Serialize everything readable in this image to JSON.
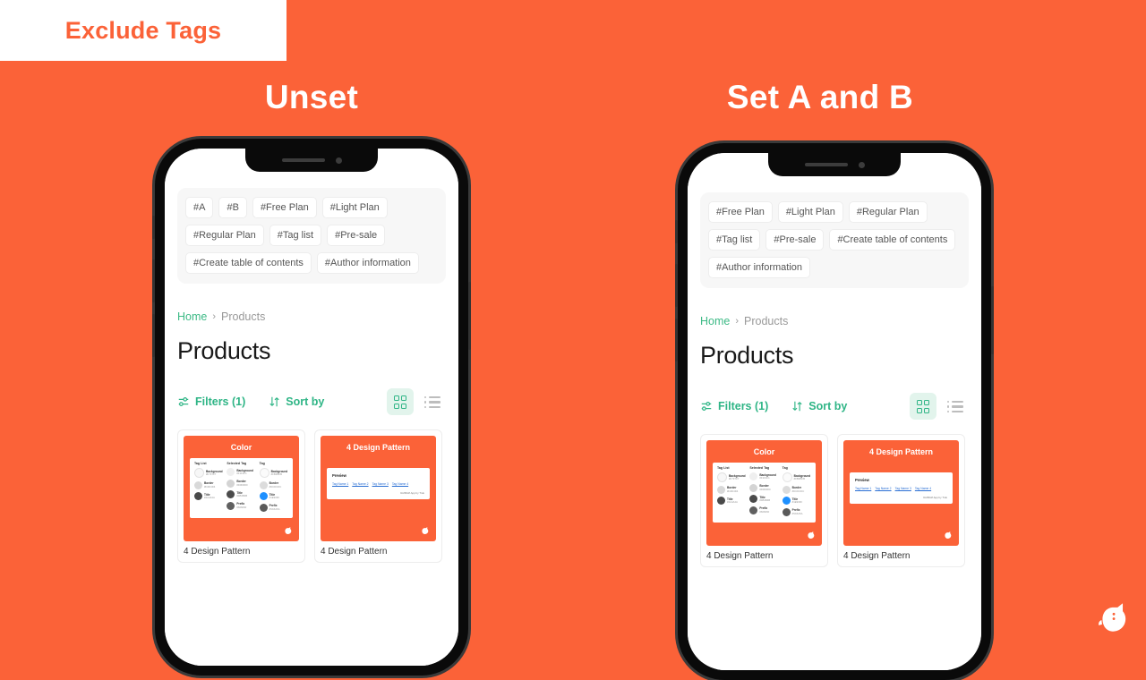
{
  "header": {
    "badge_label": "Exclude Tags"
  },
  "panels": [
    {
      "id": "unset",
      "title": "Unset",
      "app": {
        "tags": [
          "#A",
          "#B",
          "#Free Plan",
          "#Light Plan",
          "#Regular Plan",
          "#Tag list",
          "#Pre-sale",
          "#Create table of contents",
          "#Author information"
        ],
        "breadcrumb": {
          "home": "Home",
          "separator": "›",
          "current": "Products"
        },
        "page_title": "Products",
        "toolbar": {
          "filters_label": "Filters (1)",
          "sort_label": "Sort by",
          "grid_view_active": true,
          "list_view_active": false
        },
        "products": [
          {
            "thumb_title": "Color",
            "thumb_type": "color-table",
            "caption": "4 Design Pattern",
            "columns": [
              {
                "head": "Tag List",
                "swatches": [
                  {
                    "name": "Background",
                    "hex": "#F7F7F7",
                    "color": "#F7F7F7"
                  },
                  {
                    "name": "Border",
                    "hex": "#D4D4D4",
                    "color": "#D9D9D9"
                  },
                  {
                    "name": "Title",
                    "hex": "#4A4A4A",
                    "color": "#4A4A4A"
                  }
                ]
              },
              {
                "head": "Selected Tag",
                "swatches": [
                  {
                    "name": "Background",
                    "hex": "#F1F1F1",
                    "color": "#EFEFEF"
                  },
                  {
                    "name": "Border",
                    "hex": "#D0D0D0",
                    "color": "#D4D4D4"
                  },
                  {
                    "name": "Title",
                    "hex": "#4B4B4B",
                    "color": "#4B4B4B"
                  },
                  {
                    "name": "Prefix",
                    "hex": "#606060",
                    "color": "#606060"
                  }
                ]
              },
              {
                "head": "Tag",
                "swatches": [
                  {
                    "name": "Background",
                    "hex": "#FBFBFB",
                    "color": "#FBFBFB"
                  },
                  {
                    "name": "Border",
                    "hex": "#DCDCDC",
                    "color": "#DCDCDC"
                  },
                  {
                    "name": "Title",
                    "hex": "#1E90FF",
                    "color": "#1E90FF"
                  },
                  {
                    "name": "Prefix",
                    "hex": "#5A5A5A",
                    "color": "#5A5A5A"
                  }
                ]
              }
            ]
          },
          {
            "thumb_title": "4 Design Pattern",
            "thumb_type": "preview",
            "caption": "4 Design Pattern",
            "preview_head": "Preview",
            "preview_links": [
              "Tag Name 1",
              "Tag Name 2",
              "Tag Name 3",
              "Tag Name 4"
            ],
            "preview_footer": "RoffRoff App by Truk"
          }
        ]
      }
    },
    {
      "id": "set-a-and-b",
      "title": "Set A and B",
      "app": {
        "tags": [
          "#Free Plan",
          "#Light Plan",
          "#Regular Plan",
          "#Tag list",
          "#Pre-sale",
          "#Create table of contents",
          "#Author information"
        ],
        "breadcrumb": {
          "home": "Home",
          "separator": "›",
          "current": "Products"
        },
        "page_title": "Products",
        "toolbar": {
          "filters_label": "Filters (1)",
          "sort_label": "Sort by",
          "grid_view_active": true,
          "list_view_active": false
        },
        "products": [
          {
            "thumb_title": "Color",
            "thumb_type": "color-table",
            "caption": "4 Design Pattern",
            "columns": [
              {
                "head": "Tag List",
                "swatches": [
                  {
                    "name": "Background",
                    "hex": "#F7F7F7",
                    "color": "#F7F7F7"
                  },
                  {
                    "name": "Border",
                    "hex": "#D4D4D4",
                    "color": "#D9D9D9"
                  },
                  {
                    "name": "Title",
                    "hex": "#4A4A4A",
                    "color": "#4A4A4A"
                  }
                ]
              },
              {
                "head": "Selected Tag",
                "swatches": [
                  {
                    "name": "Background",
                    "hex": "#F1F1F1",
                    "color": "#EFEFEF"
                  },
                  {
                    "name": "Border",
                    "hex": "#D0D0D0",
                    "color": "#D4D4D4"
                  },
                  {
                    "name": "Title",
                    "hex": "#4B4B4B",
                    "color": "#4B4B4B"
                  },
                  {
                    "name": "Prefix",
                    "hex": "#606060",
                    "color": "#606060"
                  }
                ]
              },
              {
                "head": "Tag",
                "swatches": [
                  {
                    "name": "Background",
                    "hex": "#FBFBFB",
                    "color": "#FBFBFB"
                  },
                  {
                    "name": "Border",
                    "hex": "#DCDCDC",
                    "color": "#DCDCDC"
                  },
                  {
                    "name": "Title",
                    "hex": "#1E90FF",
                    "color": "#1E90FF"
                  },
                  {
                    "name": "Prefix",
                    "hex": "#5A5A5A",
                    "color": "#5A5A5A"
                  }
                ]
              }
            ]
          },
          {
            "thumb_title": "4 Design Pattern",
            "thumb_type": "preview",
            "caption": "4 Design Pattern",
            "preview_head": "Preview",
            "preview_links": [
              "Tag Name 1",
              "Tag Name 2",
              "Tag Name 3",
              "Tag Name 4"
            ],
            "preview_footer": "RoffRoff App by Truk"
          }
        ]
      }
    }
  ],
  "colors": {
    "brand_orange": "#FB6238",
    "accent_green": "#2FB586",
    "accent_green_bg": "#E2F4EC",
    "panel_gray": "#F7F7F7",
    "white": "#FFFFFF"
  },
  "mascot": {
    "name": "dog-head-logo"
  }
}
